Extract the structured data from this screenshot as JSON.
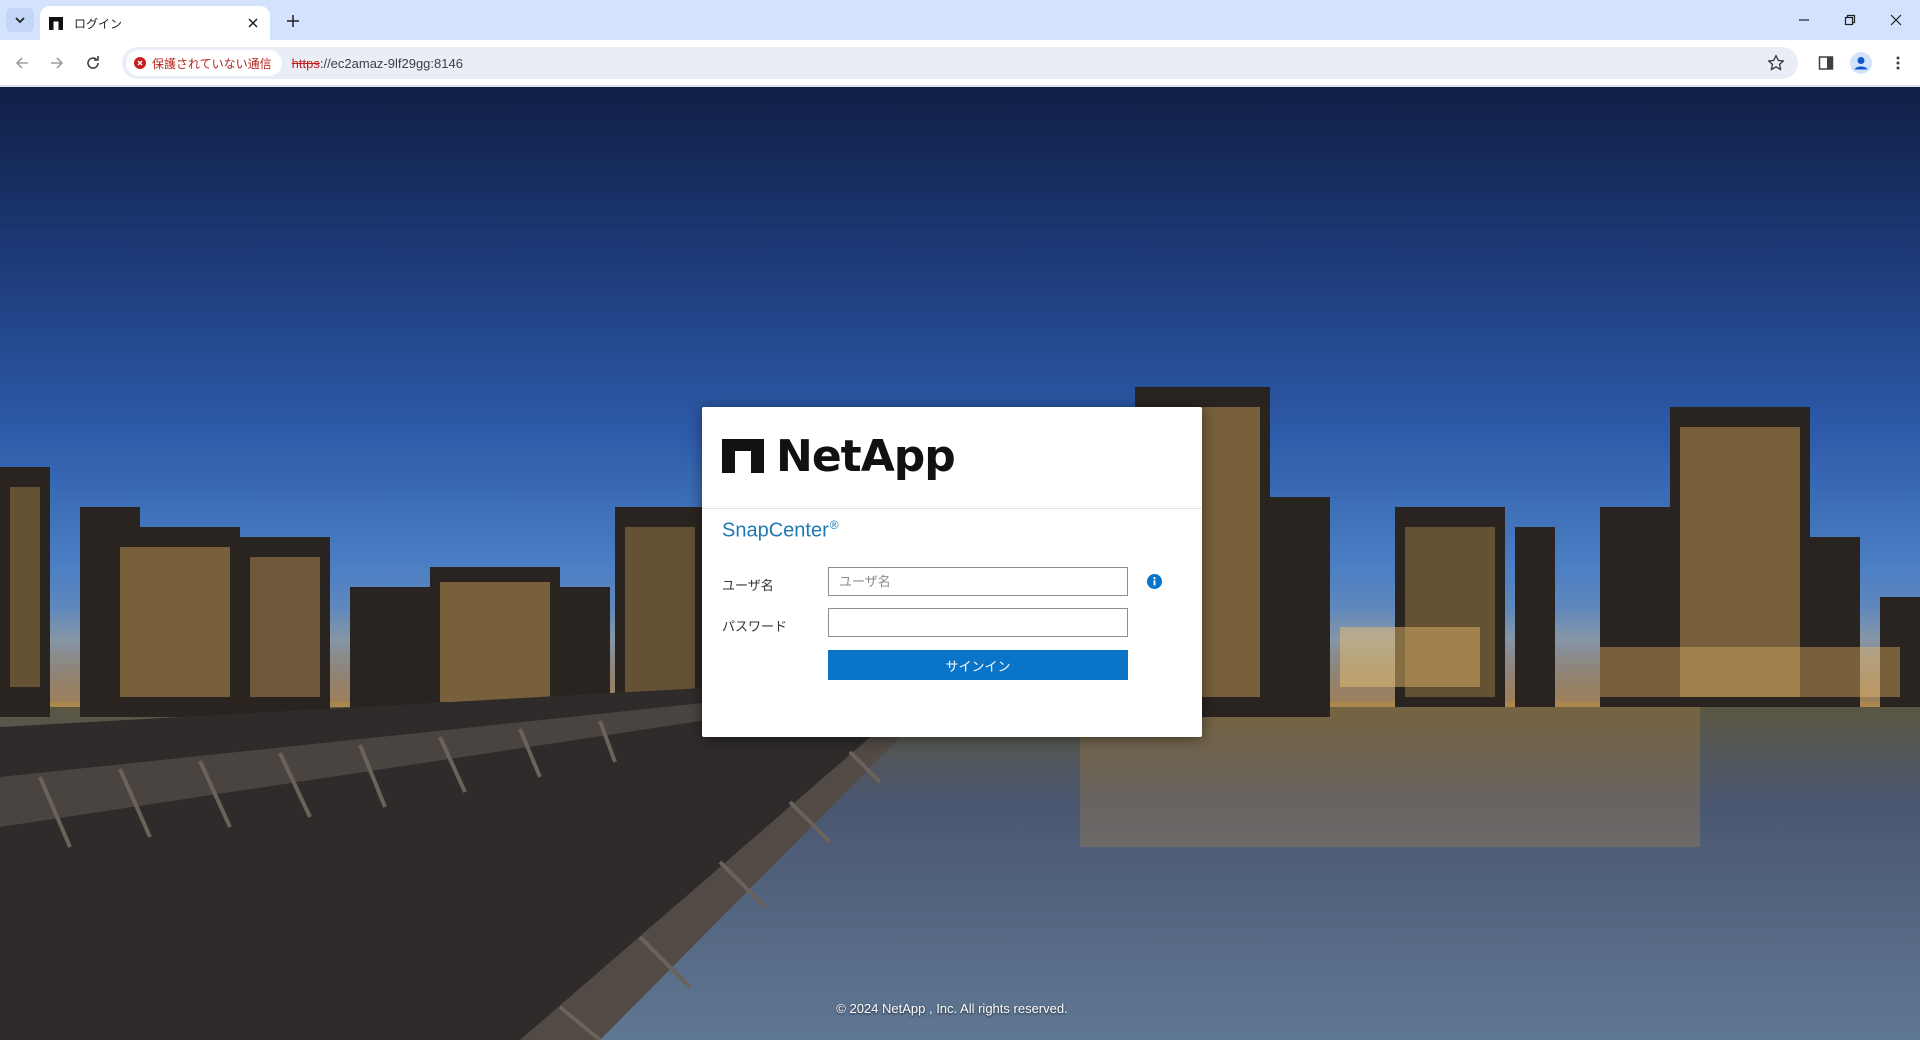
{
  "browser": {
    "tab": {
      "title": "ログイン",
      "favicon": "netapp-favicon"
    },
    "security_label": "保護されていない通信",
    "url_scheme": "https",
    "url_rest": "://ec2amaz-9lf29gg:8146"
  },
  "login": {
    "brand": "NetApp",
    "product": "SnapCenter",
    "product_mark": "®",
    "username_label": "ユーザ名",
    "username_placeholder": "ユーザ名",
    "password_label": "パスワード",
    "signin_label": "サインイン"
  },
  "footer": {
    "copyright": "© 2024 NetApp , Inc. All rights reserved."
  },
  "colors": {
    "accent": "#0a74c8",
    "product_text": "#1f78b4",
    "insecure": "#b3261e",
    "tabbar": "#d3e3fd"
  }
}
